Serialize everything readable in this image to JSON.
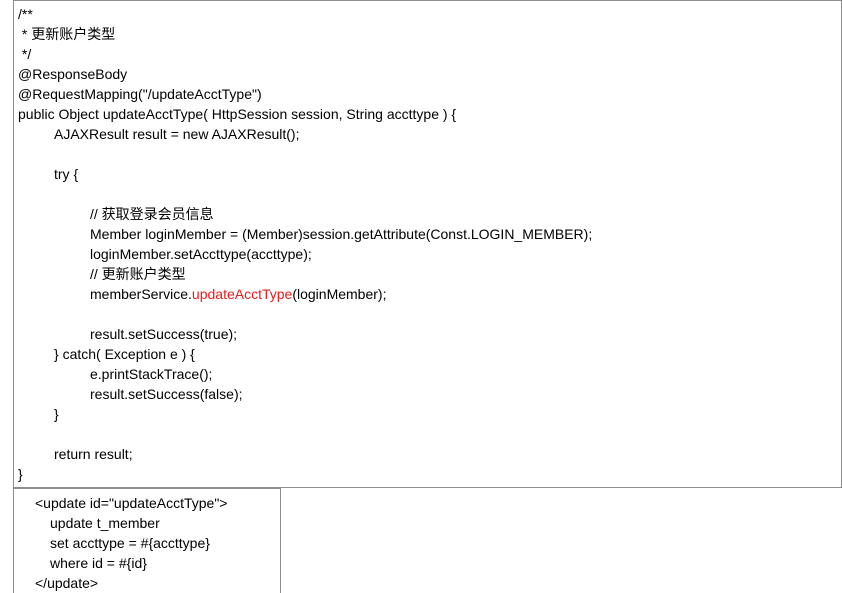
{
  "java_code": {
    "lines": [
      "/**",
      " * 更新账户类型",
      " */",
      "@ResponseBody",
      "@RequestMapping(\"/updateAcctType\")",
      "public Object updateAcctType( HttpSession session, String accttype ) {",
      "AJAXResult result = new AJAXResult();",
      "try {",
      "// 获取登录会员信息",
      "Member loginMember = (Member)session.getAttribute(Const.LOGIN_MEMBER);",
      "loginMember.setAccttype(accttype);",
      "// 更新账户类型",
      "memberService.",
      "updateAcctType",
      "(loginMember);",
      "result.setSuccess(true);",
      "} catch( Exception e ) {",
      "e.printStackTrace();",
      "result.setSuccess(false);",
      "}",
      "return result;",
      "}"
    ],
    "highlight_color": "#e02020"
  },
  "xml_code": {
    "lines": [
      "<update id=\"updateAcctType\">",
      "update t_member",
      "set accttype = #{accttype}",
      "where id = #{id}",
      "</update>"
    ]
  }
}
